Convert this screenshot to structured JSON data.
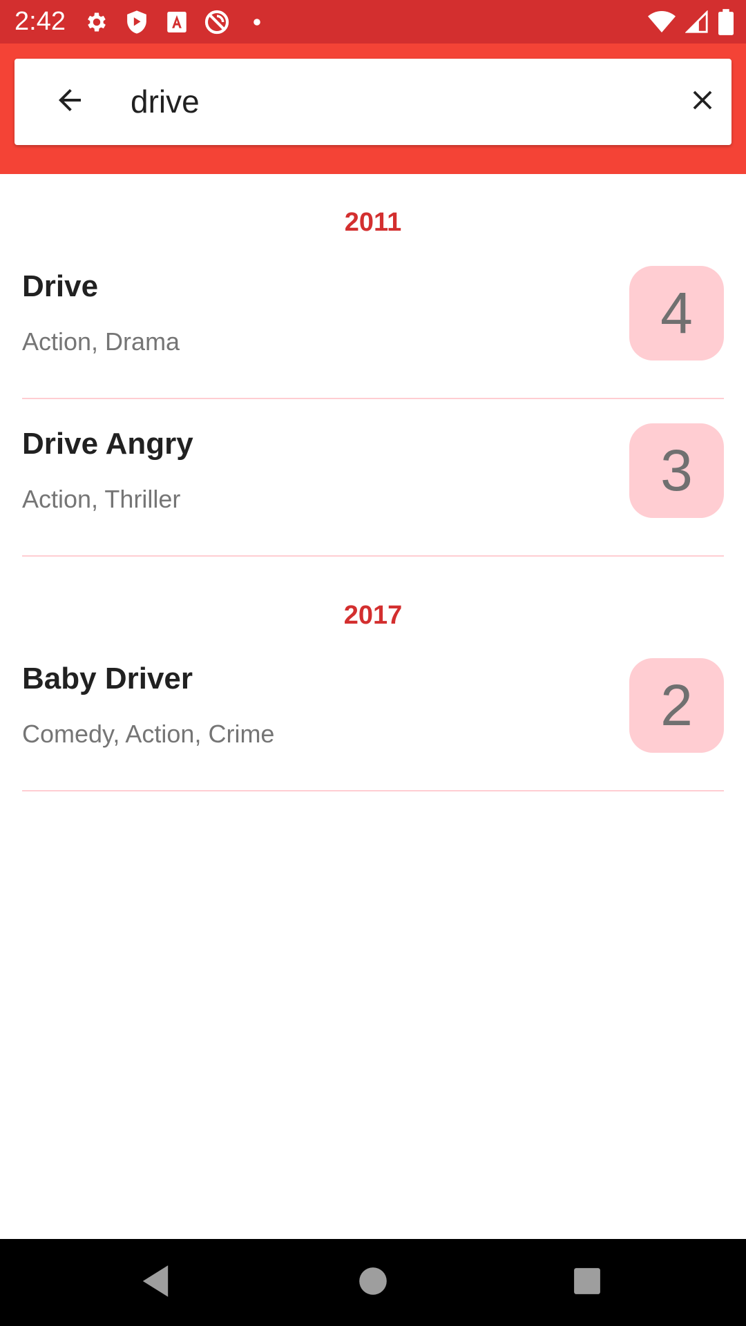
{
  "status_bar": {
    "time": "2:42",
    "left_icons": [
      "settings-icon",
      "shield-play-icon",
      "text-a-icon",
      "no-sync-icon",
      "dot-icon"
    ],
    "right_icons": [
      "wifi-icon",
      "cell-signal-icon",
      "battery-icon"
    ]
  },
  "colors": {
    "status_bar": "#d32f2f",
    "header": "#f44336",
    "accent": "#d32f2f",
    "badge_bg": "#ffcdd2",
    "divider": "#ffcdd2"
  },
  "search": {
    "back_icon": "arrow-back-icon",
    "query": "drive",
    "clear_icon": "close-icon"
  },
  "results": [
    {
      "year": "2011",
      "movies": [
        {
          "title": "Drive",
          "genres": "Action, Drama",
          "rating": "4"
        },
        {
          "title": "Drive Angry",
          "genres": "Action, Thriller",
          "rating": "3"
        }
      ]
    },
    {
      "year": "2017",
      "movies": [
        {
          "title": "Baby Driver",
          "genres": "Comedy, Action, Crime",
          "rating": "2"
        }
      ]
    }
  ],
  "nav_bar": {
    "icons": [
      "back-triangle-icon",
      "home-circle-icon",
      "recents-square-icon"
    ]
  }
}
